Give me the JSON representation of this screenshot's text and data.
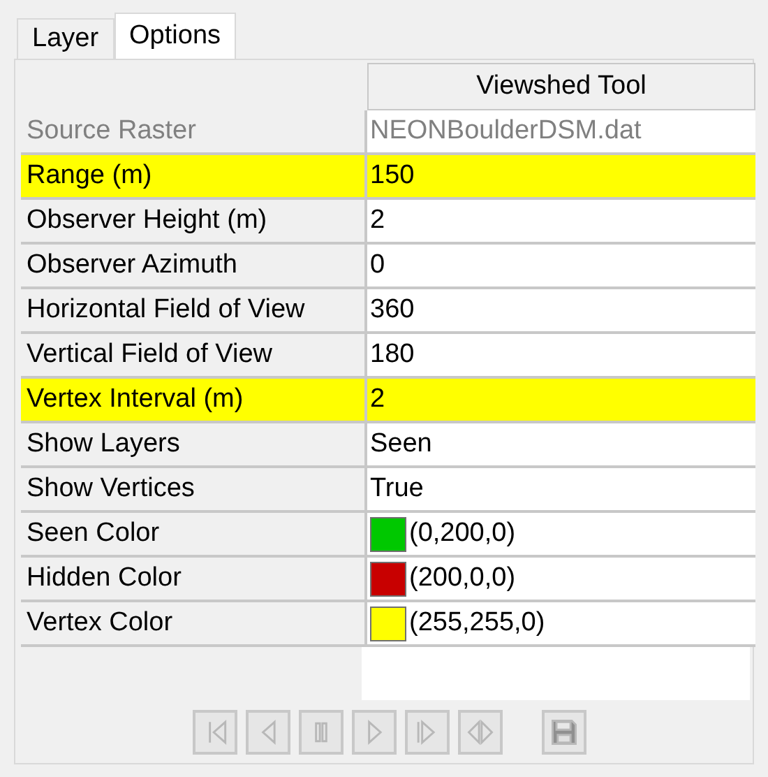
{
  "tabs": [
    {
      "label": "Layer",
      "selected": false
    },
    {
      "label": "Options",
      "selected": true
    }
  ],
  "grid": {
    "header": "Viewshed Tool",
    "rows": [
      {
        "label": "Source Raster",
        "value": "NEONBoulderDSM.dat",
        "disabled": true,
        "highlighted": false
      },
      {
        "label": "Range (m)",
        "value": "150",
        "disabled": false,
        "highlighted": true
      },
      {
        "label": "Observer Height (m)",
        "value": "2",
        "disabled": false,
        "highlighted": false
      },
      {
        "label": "Observer Azimuth",
        "value": "0",
        "disabled": false,
        "highlighted": false
      },
      {
        "label": "Horizontal Field of View",
        "value": "360",
        "disabled": false,
        "highlighted": false
      },
      {
        "label": "Vertical Field of View",
        "value": "180",
        "disabled": false,
        "highlighted": false
      },
      {
        "label": "Vertex Interval (m)",
        "value": "2",
        "disabled": false,
        "highlighted": true
      },
      {
        "label": "Show Layers",
        "value": "Seen",
        "disabled": false,
        "highlighted": false
      },
      {
        "label": "Show Vertices",
        "value": "True",
        "disabled": false,
        "highlighted": false
      },
      {
        "label": "Seen Color",
        "value": "(0,200,0)",
        "color": "#00c800",
        "disabled": false,
        "highlighted": false
      },
      {
        "label": "Hidden Color",
        "value": "(200,0,0)",
        "color": "#c80000",
        "disabled": false,
        "highlighted": false
      },
      {
        "label": "Vertex Color",
        "value": "(255,255,0)",
        "color": "#ffff00",
        "disabled": false,
        "highlighted": false
      }
    ]
  },
  "toolbar": [
    {
      "kind": "first",
      "disabled": true
    },
    {
      "kind": "previous",
      "disabled": true
    },
    {
      "kind": "pause",
      "disabled": true
    },
    {
      "kind": "next",
      "disabled": true
    },
    {
      "kind": "last",
      "disabled": true
    },
    {
      "kind": "both",
      "disabled": true
    },
    {
      "kind": "save",
      "disabled": true
    }
  ]
}
